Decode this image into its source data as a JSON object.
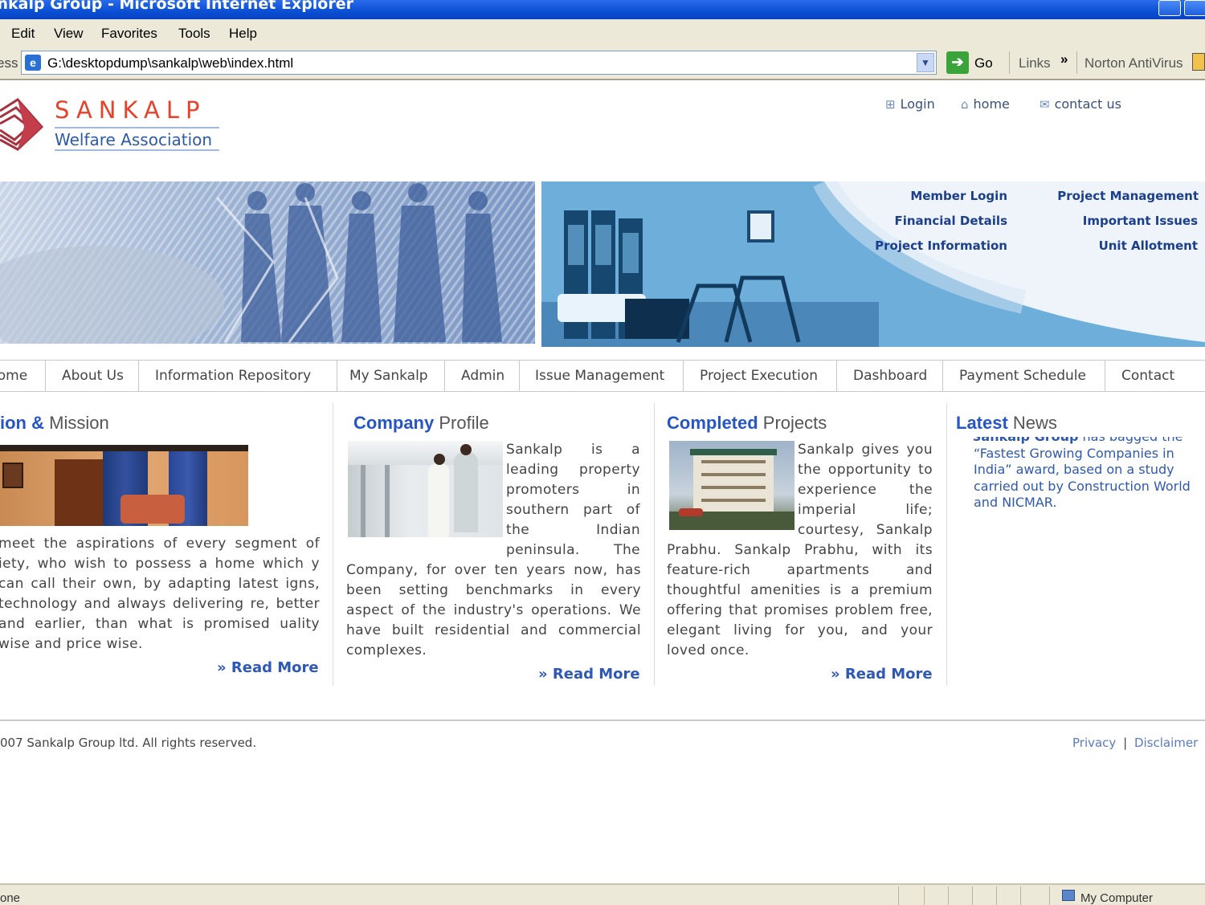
{
  "window": {
    "title": "Sankalp Group - Microsoft Internet Explorer",
    "title_visible": "ankalp Group - Microsoft Internet Explorer"
  },
  "menu": [
    "Edit",
    "View",
    "Favorites",
    "Tools",
    "Help"
  ],
  "address_bar": {
    "label": "ess",
    "url": "G:\\desktopdump\\sankalp\\web\\index.html",
    "go_label": "Go",
    "links_label": "Links",
    "chevron": "»",
    "norton_label": "Norton AntiVirus"
  },
  "brand": {
    "name": "SANKALP",
    "subtitle": "Welfare Association"
  },
  "top_links": {
    "login": "Login",
    "home": "home",
    "contact": "contact us"
  },
  "quick_links": {
    "member_login": "Member Login",
    "financial_details": "Financial Details",
    "project_information": "Project Information",
    "project_management": "Project Management",
    "important_issues": "Important Issues",
    "unit_allotment": "Unit Allotment"
  },
  "nav": [
    "Home",
    "About Us",
    "Information Repository",
    "My Sankalp",
    "Admin",
    "Issue Management",
    "Project Execution",
    "Dashboard",
    "Payment Schedule",
    "Contact"
  ],
  "columns": {
    "vision": {
      "title_bold": "ion &",
      "title_rest": " Mission",
      "text": "meet the aspirations of every segment of iety, who wish to possess a home which y can call their own, by adapting latest igns, technology and always delivering re, better and earlier, than what is promised uality wise and price wise.",
      "read_more": "» Read More"
    },
    "company": {
      "title_bold": "Company",
      "title_rest": " Profile",
      "text_side": "Sankalp is a leading property promoters in southern part of the Indian peninsula. The",
      "text_below": "Company, for over ten years now, has been setting benchmarks in every aspect of the industry's operations. We have built residential and commercial complexes.",
      "read_more": "» Read More"
    },
    "projects": {
      "title_bold": "Completed",
      "title_rest": " Projects",
      "text_side": "Sankalp gives you the opportunity to experience the imperial life; courtesy, Sankalp",
      "text_below": "Prabhu. Sankalp Prabhu, with its feature-rich apartments and thoughtful amenities is a premium offering that promises problem free, elegant living for you, and your loved once.",
      "read_more": "» Read More"
    },
    "news": {
      "title_bold": "Latest",
      "title_rest": " News",
      "item_bold": "» Sankalp Group",
      "item_rest": " has bagged the “Fastest Growing Companies in India” award, based on a study carried out by Construction World and NICMAR."
    }
  },
  "footer": {
    "copyright": "007 Sankalp Group ltd. All rights reserved.",
    "privacy": "Privacy",
    "separator": "|",
    "disclaimer": "Disclaimer"
  },
  "status_bar": {
    "left": "one",
    "right": "My Computer"
  },
  "colors": {
    "title_blue": "#0a4fd4",
    "chrome_beige": "#ece9d8",
    "brand_red": "#e8412b",
    "link_blue": "#2655c5",
    "quick_link_navy": "#1c3f8c"
  }
}
